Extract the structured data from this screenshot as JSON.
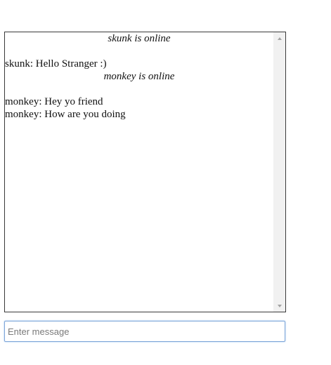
{
  "chat": {
    "messages": [
      {
        "type": "status",
        "text": "skunk is online"
      },
      {
        "type": "blank",
        "text": ""
      },
      {
        "type": "message",
        "text": "skunk: Hello Stranger :)"
      },
      {
        "type": "status",
        "text": "monkey is online"
      },
      {
        "type": "blank",
        "text": ""
      },
      {
        "type": "message",
        "text": "monkey: Hey yo friend"
      },
      {
        "type": "message",
        "text": "monkey: How are you doing"
      }
    ]
  },
  "input": {
    "placeholder": "Enter message",
    "value": ""
  },
  "icons": {
    "scroll_up": "triangle-up-icon",
    "scroll_down": "triangle-down-icon"
  },
  "colors": {
    "border": "#3a3a3a",
    "scrollbar_track": "#f1f1f1",
    "input_focus_border": "#7ea6d8"
  }
}
